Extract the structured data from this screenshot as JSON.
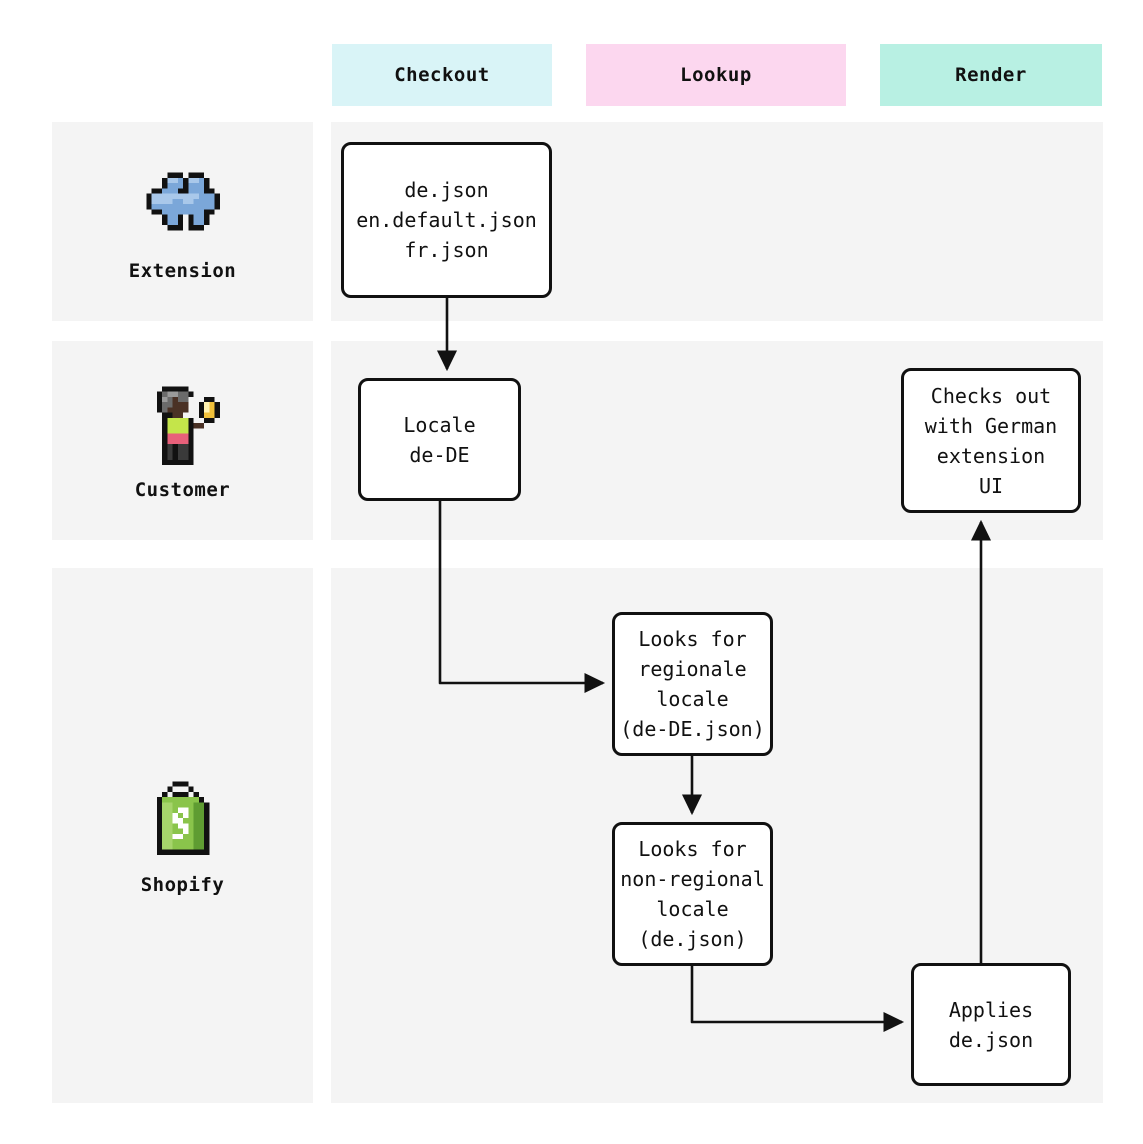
{
  "phases": [
    {
      "id": "checkout",
      "label": "Checkout",
      "color": "#d9f4f7"
    },
    {
      "id": "lookup",
      "label": "Lookup",
      "color": "#fcd7ef"
    },
    {
      "id": "render",
      "label": "Render",
      "color": "#b8f0e3"
    }
  ],
  "lanes": [
    {
      "id": "extension",
      "label": "Extension",
      "icon": "puzzle-piece-icon"
    },
    {
      "id": "customer",
      "label": "Customer",
      "icon": "customer-person-icon"
    },
    {
      "id": "shopify",
      "label": "Shopify",
      "icon": "shopify-bag-icon"
    }
  ],
  "nodes": {
    "files": {
      "text": "de.json\nen.default.json\nfr.json"
    },
    "locale": {
      "text": "Locale\nde-DE"
    },
    "regional": {
      "text": "Looks for\nregionale\nlocale\n(de-DE.json)"
    },
    "nonregional": {
      "text": "Looks for\nnon-regional\nlocale\n(de.json)"
    },
    "applies": {
      "text": "Applies\nde.json"
    },
    "checksout": {
      "text": "Checks out\nwith German\nextension\nUI"
    }
  },
  "colors": {
    "lane_background": "#f4f4f4",
    "page_background": "#ffffff",
    "node_border": "#111111",
    "node_fill": "#ffffff",
    "connector": "#111111",
    "text": "#111111"
  },
  "connectors": [
    {
      "id": "files-to-locale",
      "from": "files",
      "to": "locale"
    },
    {
      "id": "locale-to-regional",
      "from": "locale",
      "to": "regional"
    },
    {
      "id": "regional-to-nonregional",
      "from": "regional",
      "to": "nonregional"
    },
    {
      "id": "nonregional-to-applies",
      "from": "nonregional",
      "to": "applies"
    },
    {
      "id": "applies-to-checksout",
      "from": "applies",
      "to": "checksout"
    }
  ]
}
